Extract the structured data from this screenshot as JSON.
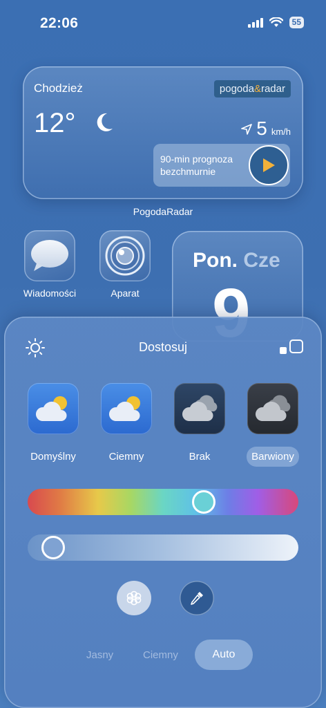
{
  "status": {
    "time": "22:06",
    "battery": "55"
  },
  "widget": {
    "city": "Chodzież",
    "brand_left": "pogoda",
    "brand_amp": "&",
    "brand_right": "radar",
    "temperature": "12°",
    "wind_value": "5",
    "wind_unit": "km/h",
    "forecast_line1": "90-min prognoza",
    "forecast_line2": "bezchmurnie",
    "label": "PogodaRadar"
  },
  "apps": [
    {
      "label": "Wiadomości",
      "icon": "messages-icon"
    },
    {
      "label": "Aparat",
      "icon": "camera-icon"
    }
  ],
  "date_widget": {
    "day": "Pon.",
    "day_next": "Cze",
    "number": "9"
  },
  "panel": {
    "title": "Dostosuj",
    "styles": [
      {
        "label": "Domyślny",
        "selected": false
      },
      {
        "label": "Ciemny",
        "selected": false
      },
      {
        "label": "Brak",
        "selected": false
      },
      {
        "label": "Barwiony",
        "selected": true
      }
    ],
    "hue_level": 0.66,
    "saturation_level": 0.05,
    "modes": [
      "Jasny",
      "Ciemny",
      "Auto"
    ],
    "selected_mode": "Auto"
  },
  "colors": {
    "accent_play": "#f3b13a",
    "sun_yellow": "#f1c232"
  }
}
